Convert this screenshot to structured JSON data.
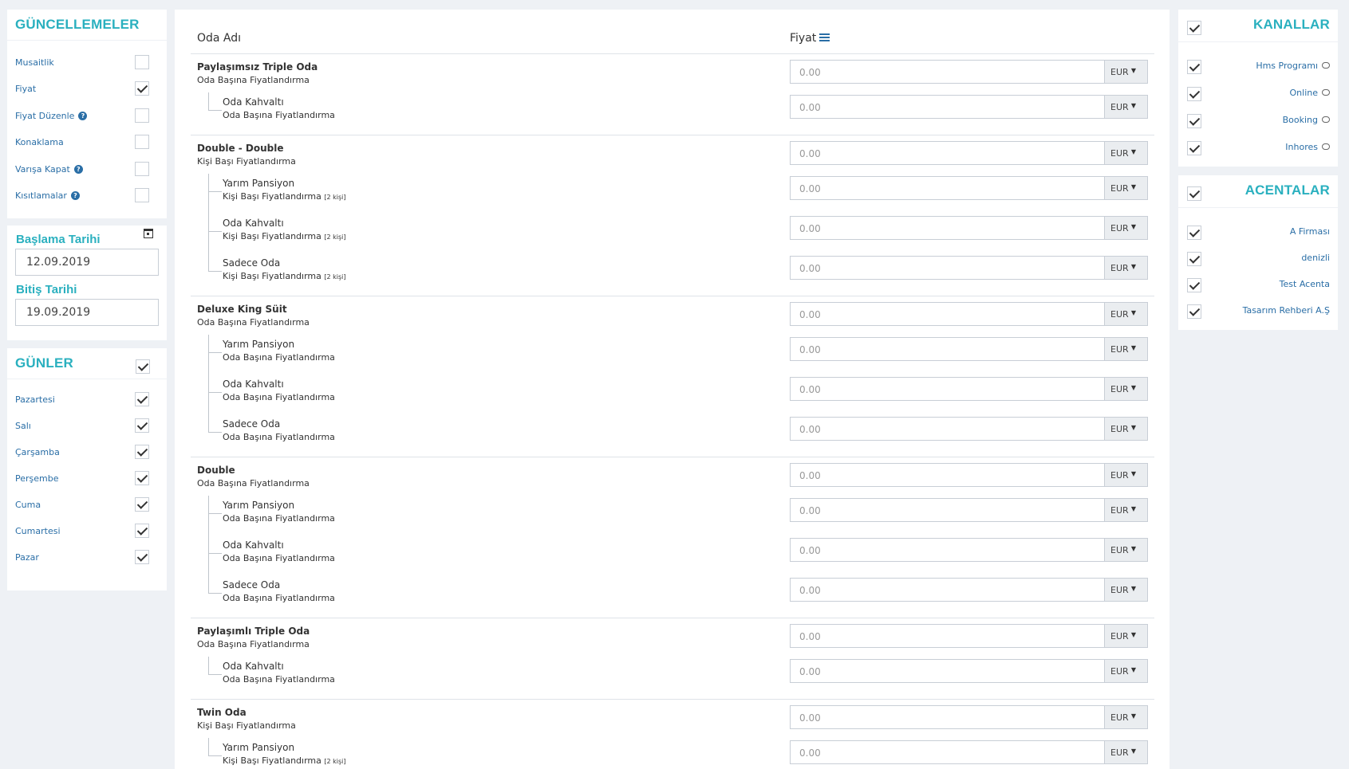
{
  "updates": {
    "title": "GÜNCELLEMELER",
    "items": [
      {
        "label": "Musaitlik",
        "checked": false,
        "help": false
      },
      {
        "label": "Fiyat",
        "checked": true,
        "help": false
      },
      {
        "label": "Fiyat Düzenle",
        "checked": false,
        "help": true
      },
      {
        "label": "Konaklama",
        "checked": false,
        "help": false
      },
      {
        "label": "Varışa Kapat",
        "checked": false,
        "help": true
      },
      {
        "label": "Kısıtlamalar",
        "checked": false,
        "help": true
      }
    ]
  },
  "dates": {
    "start_label": "Başlama Tarihi",
    "start_value": "12.09.2019",
    "end_label": "Bitiş Tarihi",
    "end_value": "19.09.2019"
  },
  "days": {
    "title": "GÜNLER",
    "all_checked": true,
    "items": [
      {
        "label": "Pazartesi",
        "checked": true
      },
      {
        "label": "Salı",
        "checked": true
      },
      {
        "label": "Çarşamba",
        "checked": true
      },
      {
        "label": "Perşembe",
        "checked": true
      },
      {
        "label": "Cuma",
        "checked": true
      },
      {
        "label": "Cumartesi",
        "checked": true
      },
      {
        "label": "Pazar",
        "checked": true
      }
    ]
  },
  "table": {
    "col_room": "Oda Adı",
    "col_price": "Fiyat",
    "placeholder": "0.00",
    "currency": "EUR",
    "rooms": [
      {
        "name": "Paylaşımsız Triple Oda",
        "pricing": "Oda Başına Fiyatlandırma",
        "subs": [
          {
            "name": "Oda Kahvaltı",
            "pricing": "Oda Başına Fiyatlandırma",
            "note": ""
          }
        ]
      },
      {
        "name": "Double - Double",
        "pricing": "Kişi Başı Fiyatlandırma",
        "subs": [
          {
            "name": "Yarım Pansiyon",
            "pricing": "Kişi Başı Fiyatlandırma",
            "note": "[2 kişi]"
          },
          {
            "name": "Oda Kahvaltı",
            "pricing": "Kişi Başı Fiyatlandırma",
            "note": "[2 kişi]"
          },
          {
            "name": "Sadece Oda",
            "pricing": "Kişi Başı Fiyatlandırma",
            "note": "[2 kişi]"
          }
        ]
      },
      {
        "name": "Deluxe King Süit",
        "pricing": "Oda Başına Fiyatlandırma",
        "subs": [
          {
            "name": "Yarım Pansiyon",
            "pricing": "Oda Başına Fiyatlandırma",
            "note": ""
          },
          {
            "name": "Oda Kahvaltı",
            "pricing": "Oda Başına Fiyatlandırma",
            "note": ""
          },
          {
            "name": "Sadece Oda",
            "pricing": "Oda Başına Fiyatlandırma",
            "note": ""
          }
        ]
      },
      {
        "name": "Double",
        "pricing": "Oda Başına Fiyatlandırma",
        "subs": [
          {
            "name": "Yarım Pansiyon",
            "pricing": "Oda Başına Fiyatlandırma",
            "note": ""
          },
          {
            "name": "Oda Kahvaltı",
            "pricing": "Oda Başına Fiyatlandırma",
            "note": ""
          },
          {
            "name": "Sadece Oda",
            "pricing": "Oda Başına Fiyatlandırma",
            "note": ""
          }
        ]
      },
      {
        "name": "Paylaşımlı Triple Oda",
        "pricing": "Oda Başına Fiyatlandırma",
        "subs": [
          {
            "name": "Oda Kahvaltı",
            "pricing": "Oda Başına Fiyatlandırma",
            "note": ""
          }
        ]
      },
      {
        "name": "Twin Oda",
        "pricing": "Kişi Başı Fiyatlandırma",
        "subs": [
          {
            "name": "Yarım Pansiyon",
            "pricing": "Kişi Başı Fiyatlandırma",
            "note": "[2 kişi]"
          }
        ]
      }
    ]
  },
  "channels": {
    "title": "KANALLAR",
    "all_checked": true,
    "items": [
      {
        "label": "Hms Programı",
        "checked": true
      },
      {
        "label": "Online",
        "checked": true
      },
      {
        "label": "Booking",
        "checked": true
      },
      {
        "label": "Inhores",
        "checked": true
      }
    ]
  },
  "agencies": {
    "title": "ACENTALAR",
    "all_checked": true,
    "items": [
      {
        "label": "A Firması",
        "checked": true
      },
      {
        "label": "denizli",
        "checked": true
      },
      {
        "label": "Test Acenta",
        "checked": true
      },
      {
        "label": "Tasarım Rehberi A.Ş",
        "checked": true
      }
    ]
  }
}
